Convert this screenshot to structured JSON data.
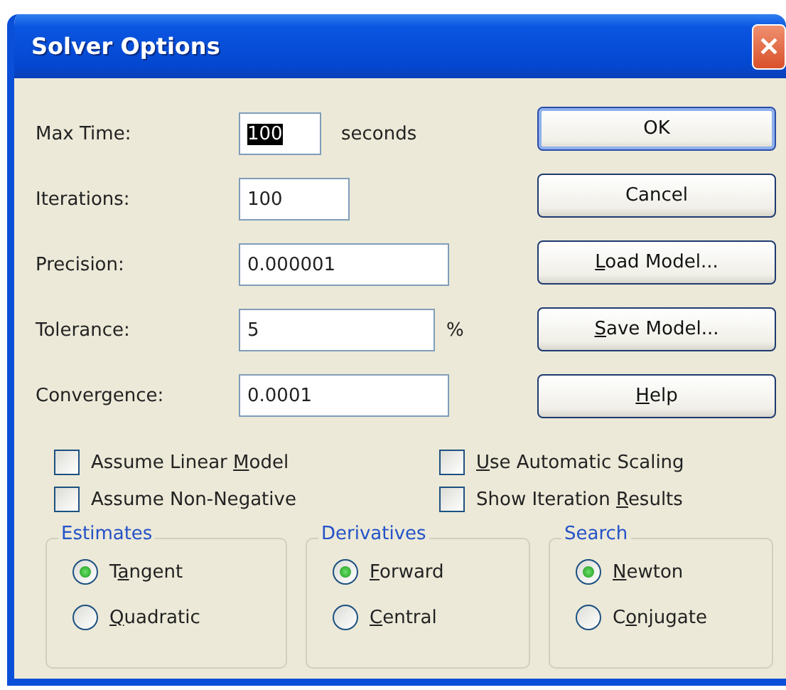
{
  "window": {
    "title": "Solver Options",
    "close": "✕"
  },
  "fields": [
    {
      "label": "Max Time:",
      "value": "100",
      "unit": "seconds",
      "highlighted": true
    },
    {
      "label": "Iterations:",
      "value": "100",
      "highlighted": false
    },
    {
      "label": "Precision:",
      "value": "0.000001",
      "highlighted": false
    },
    {
      "label": "Tolerance:",
      "value": "5",
      "unit": "%",
      "highlighted": false
    },
    {
      "label": "Convergence:",
      "value": "0.0001",
      "highlighted": false
    }
  ],
  "buttons": [
    {
      "label": {
        "before": "OK"
      },
      "default": true
    },
    {
      "label": {
        "before": "Cancel"
      },
      "default": false
    },
    {
      "label": {
        "key": "L",
        "after": "oad Model..."
      },
      "default": false
    },
    {
      "label": {
        "key": "S",
        "after": "ave Model..."
      },
      "default": false
    },
    {
      "label": {
        "key": "H",
        "after": "elp"
      },
      "default": false
    }
  ],
  "checkboxes": [
    {
      "label": {
        "before": "Assume Linear ",
        "key": "M",
        "after": "odel"
      },
      "checked": false
    },
    {
      "label": {
        "key": "U",
        "after": "se Automatic Scaling"
      },
      "checked": false
    },
    {
      "label": {
        "before": "Assume Non-Ne",
        "key": "g",
        "after": "ative"
      },
      "checked": false
    },
    {
      "label": {
        "before": "Show Iteration ",
        "key": "R",
        "after": "esults"
      },
      "checked": false
    }
  ],
  "groups": [
    {
      "title": "Estimates",
      "options": [
        {
          "label": {
            "before": "T",
            "key": "a",
            "after": "ngent"
          },
          "selected": true
        },
        {
          "label": {
            "key": "Q",
            "after": "uadratic"
          },
          "selected": false
        }
      ]
    },
    {
      "title": "Derivatives",
      "options": [
        {
          "label": {
            "key": "F",
            "after": "orward"
          },
          "selected": true
        },
        {
          "label": {
            "key": "C",
            "after": "entral"
          },
          "selected": false
        }
      ]
    },
    {
      "title": "Search",
      "options": [
        {
          "label": {
            "key": "N",
            "after": "ewton"
          },
          "selected": true
        },
        {
          "label": {
            "before": "C",
            "key": "o",
            "after": "njugate"
          },
          "selected": false
        }
      ]
    }
  ]
}
